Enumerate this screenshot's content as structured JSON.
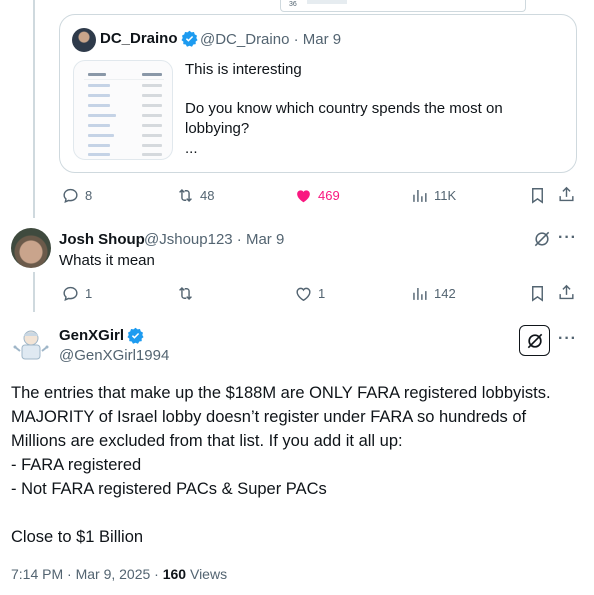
{
  "quoted_tweet": {
    "name": "DC_Draino",
    "handle": "@DC_Draino",
    "date": "· Mar 9",
    "lines": [
      "This is interesting",
      "Do you know which country spends the most on lobbying?",
      "..."
    ]
  },
  "parent_actions": {
    "replies": "8",
    "reposts": "48",
    "likes": "469",
    "views": "11K"
  },
  "reply": {
    "name": "Josh Shoup",
    "handle": "@Jshoup123",
    "date": "· Mar 9",
    "text": "Whats it mean",
    "actions": {
      "replies": "1",
      "likes": "1",
      "views": "142"
    }
  },
  "main_tweet": {
    "name": "GenXGirl",
    "handle": "@GenXGirl1994",
    "body": [
      "The entries that make up the $188M are ONLY FARA registered lobbyists. MAJORITY of Israel lobby doesn’t register under FARA so hundreds of Millions are excluded from that list. If you add it all up:",
      "- FARA registered",
      "- Not FARA registered PACs & Super PACs",
      "",
      "Close to $1 Billion"
    ],
    "time": "7:14 PM · Mar 9, 2025 · ",
    "views_count": "160",
    "views_label": " Views"
  },
  "top_fragment": {
    "row_number": "36"
  },
  "colors": {
    "text": "#0f1419",
    "secondary": "#536471",
    "like": "#f91880",
    "verified": "#1d9bf0",
    "border": "#cfd9de"
  },
  "icons": [
    "reply-icon",
    "repost-icon",
    "like-icon",
    "views-icon",
    "bookmark-icon",
    "share-icon",
    "grok-icon",
    "more-icon",
    "verified-badge-icon"
  ]
}
